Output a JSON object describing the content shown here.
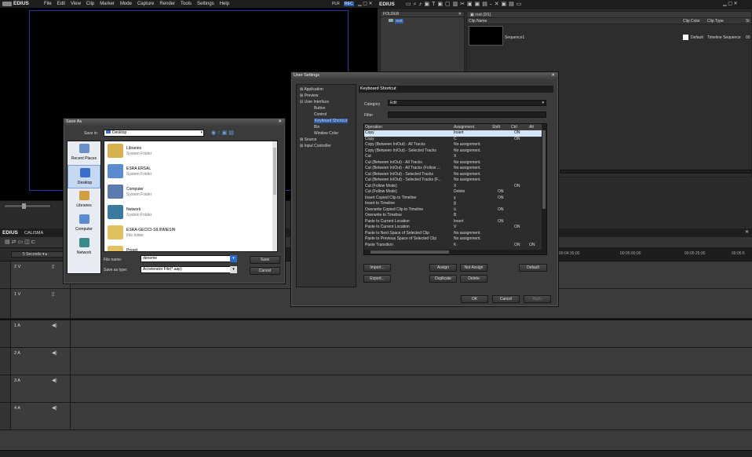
{
  "app": {
    "logo": "EDIUS",
    "menu": [
      "File",
      "Edit",
      "View",
      "Clip",
      "Marker",
      "Mode",
      "Capture",
      "Render",
      "Tools",
      "Settings",
      "Help"
    ],
    "plr": "PLR",
    "rec": "REC"
  },
  "bin": {
    "logo": "EDIUS",
    "folder_header": "FOLDER",
    "root": "root",
    "path": "root (0/1)",
    "col_name": "Clip Name",
    "col_color": "Clip Color",
    "col_type": "Clip Type",
    "col_st": "St",
    "clip_name": "Sequence1",
    "clip_color": "Default",
    "clip_type": "Timeline Sequence",
    "clip_st": "00"
  },
  "timeline": {
    "logo": "EDIUS",
    "project": "CALISMA",
    "zoom": "5 Seconds",
    "ruler": [
      "00:04:35;00",
      "00:05:00;00",
      "00:05:25;00",
      "00:05:5"
    ],
    "tracks": [
      "2 V",
      "1 V",
      "1 A",
      "2 A",
      "3 A",
      "4 A"
    ]
  },
  "save_as": {
    "title": "Save As",
    "save_in_label": "Save in:",
    "save_in_value": "Desktop",
    "places": [
      "Recent Places",
      "Desktop",
      "Libraries",
      "Computer",
      "Network"
    ],
    "items": [
      {
        "name": "Libraries",
        "sub": "System Folder"
      },
      {
        "name": "ESRA ERSAL",
        "sub": "System Folder"
      },
      {
        "name": "Computer",
        "sub": "System Folder"
      },
      {
        "name": "Network",
        "sub": "System Folder"
      },
      {
        "name": "ESRA-GECICI-SILINMESIN",
        "sub": "File folder"
      },
      {
        "name": "Preset",
        "sub": ""
      }
    ],
    "file_name_label": "File name:",
    "file_name": "deneme",
    "type_label": "Save as type:",
    "type_value": "Accelerator File(*.aap)",
    "save": "Save",
    "cancel": "Cancel"
  },
  "settings": {
    "title": "User Settings",
    "tree": {
      "application": "Application",
      "preview": "Preview",
      "user_interface": "User Interface",
      "button": "Button",
      "control": "Control",
      "keyboard": "Keyboard Shortcut",
      "bin": "Bin",
      "window_color": "Window Color",
      "source": "Source",
      "input_controller": "Input Controller"
    },
    "panel_title": "Keyboard Shortcut",
    "category_label": "Category",
    "category_value": "Edit",
    "filter_label": "Filter",
    "cols": [
      "Operation",
      "Assignment",
      "Shift",
      "Ctrl",
      "Alt"
    ],
    "rows": [
      [
        "Copy",
        "Insert",
        "",
        "ON",
        ""
      ],
      [
        "Copy",
        "C",
        "",
        "ON",
        ""
      ],
      [
        "Copy (Between In/Out) - All Tracks",
        "No assignment.",
        "",
        "",
        ""
      ],
      [
        "Copy (Between In/Out) - Selected Tracks",
        "No assignment.",
        "",
        "",
        ""
      ],
      [
        "Cut",
        "X",
        "",
        "",
        ""
      ],
      [
        "Cut (Between In/Out) - All Tracks",
        "No assignment.",
        "",
        "",
        ""
      ],
      [
        "Cut (Between In/Out) - All Tracks (Follow ...",
        "No assignment.",
        "",
        "",
        ""
      ],
      [
        "Cut (Between In/Out) - Selected Tracks",
        "No assignment.",
        "",
        "",
        ""
      ],
      [
        "Cut (Between In/Out) - Selected Tracks (F...",
        "No assignment.",
        "",
        "",
        ""
      ],
      [
        "Cut (Follow Mode)",
        "X",
        "",
        "ON",
        ""
      ],
      [
        "Cut (Follow Mode)",
        "Delete",
        "ON",
        "",
        ""
      ],
      [
        "Insert Copied Clip to Timeline",
        "ş",
        "ON",
        "",
        ""
      ],
      [
        "Insert to Timeline",
        "ğ",
        "",
        "",
        ""
      ],
      [
        "Overwrite Copied Clip to Timeline",
        "ü",
        "ON",
        "",
        ""
      ],
      [
        "Overwrite to Timeline",
        "B",
        "",
        "",
        ""
      ],
      [
        "Paste to Current Location",
        "Insert",
        "ON",
        "",
        ""
      ],
      [
        "Paste to Current Location",
        "V",
        "",
        "ON",
        ""
      ],
      [
        "Paste to Next Space of Selected Clip",
        "No assignment.",
        "",
        "",
        ""
      ],
      [
        "Paste to Previous Space of Selected Clip",
        "No assignment.",
        "",
        "",
        ""
      ],
      [
        "Paste Transition",
        "K",
        "",
        "ON",
        "ON"
      ]
    ],
    "buttons": {
      "import": "Import...",
      "export": "Export...",
      "assign": "Assign",
      "not_assign": "Not Assign",
      "duplicate": "Duplicate",
      "delete": "Delete",
      "default": "Default",
      "ok": "OK",
      "cancel": "Cancel",
      "apply": "Apply"
    }
  }
}
